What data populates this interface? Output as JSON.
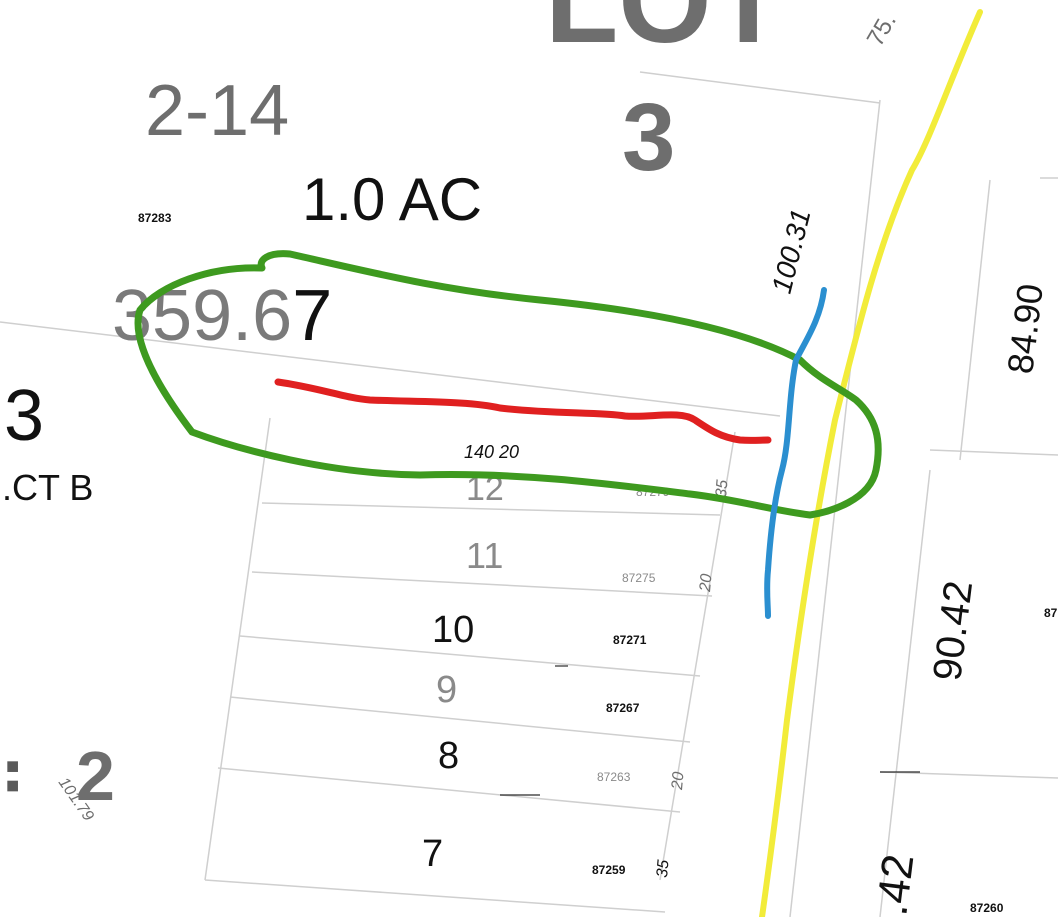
{
  "labels": {
    "lot_word": "LOT",
    "lot_number": "3",
    "parcel_id": "2-14",
    "acreage": "1.0 AC",
    "parcel_number_left": "87283",
    "dimension_main_grey": "359.6",
    "dimension_main_black": "7",
    "dimension_segment": "140 20",
    "left_edge_number": "3",
    "left_edge_tract": ".CT B",
    "diag_75": "75.",
    "diag_100_31": "100.31",
    "right_84_90": "84.90",
    "right_90_42": "90.42",
    "bottom_42": ".42",
    "bottom_right_parcel": "87260",
    "right_edge_parcel": "87",
    "lower_block_number": "2",
    "lower_diag_101_79": "101.79",
    "lower_left_marks": "■ ■"
  },
  "subdivision_lots": [
    {
      "lot": "12",
      "parcel": "87279",
      "frontage": "35"
    },
    {
      "lot": "11",
      "parcel": "87275",
      "frontage": "20"
    },
    {
      "lot": "10",
      "parcel": "87271",
      "frontage": ""
    },
    {
      "lot": "9",
      "parcel": "87267",
      "frontage": ""
    },
    {
      "lot": "8",
      "parcel": "87263",
      "frontage": "20"
    },
    {
      "lot": "7",
      "parcel": "87259",
      "frontage": "35"
    }
  ],
  "colors": {
    "road_centerline": "#f2ec3a",
    "outline_area": "#3e9a1f",
    "red_mark": "#e02020",
    "blue_mark": "#2b8fd0",
    "grey_text": "#6e6e6e",
    "black_text": "#111111"
  }
}
